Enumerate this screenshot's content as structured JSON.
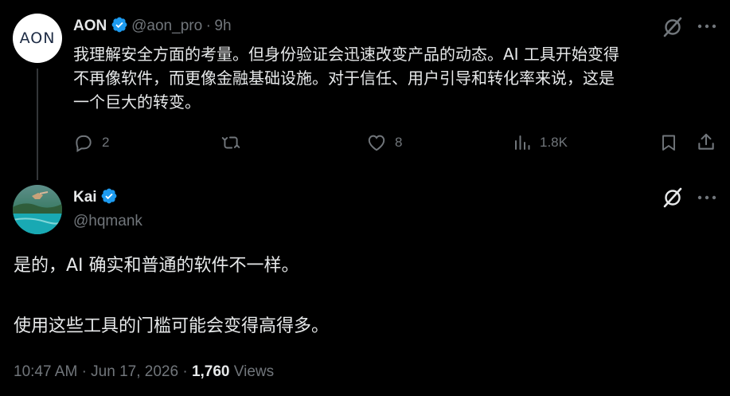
{
  "reply": {
    "avatar_text": "AON",
    "author_name": "AON",
    "handle": "@aon_pro",
    "separator": "·",
    "time": "9h",
    "text_lines": [
      "我理解安全方面的考量。但身份验证会迅速改变产品的动态。AI 工具开始变得",
      "不再像软件，而更像金融基础设施。对于信任、用户引导和转化率来说，这是",
      "一个巨大的转变。"
    ],
    "actions": {
      "replies": "2",
      "retweets": "",
      "likes": "8",
      "views": "1.8K"
    }
  },
  "main": {
    "author_name": "Kai",
    "handle": "@hqmank",
    "text_lines": [
      "是的，AI 确实和普通的软件不一样。",
      "使用这些工具的门槛可能会变得高得多。"
    ],
    "time": "10:47 AM",
    "date": "Jun 17, 2026",
    "separator": "·",
    "views_count": "1,760",
    "views_label": "Views"
  },
  "colors": {
    "background": "#000000",
    "text": "#e7e9ea",
    "muted": "#71767b",
    "verified": "#1d9bf0",
    "divider": "#2f3336"
  }
}
